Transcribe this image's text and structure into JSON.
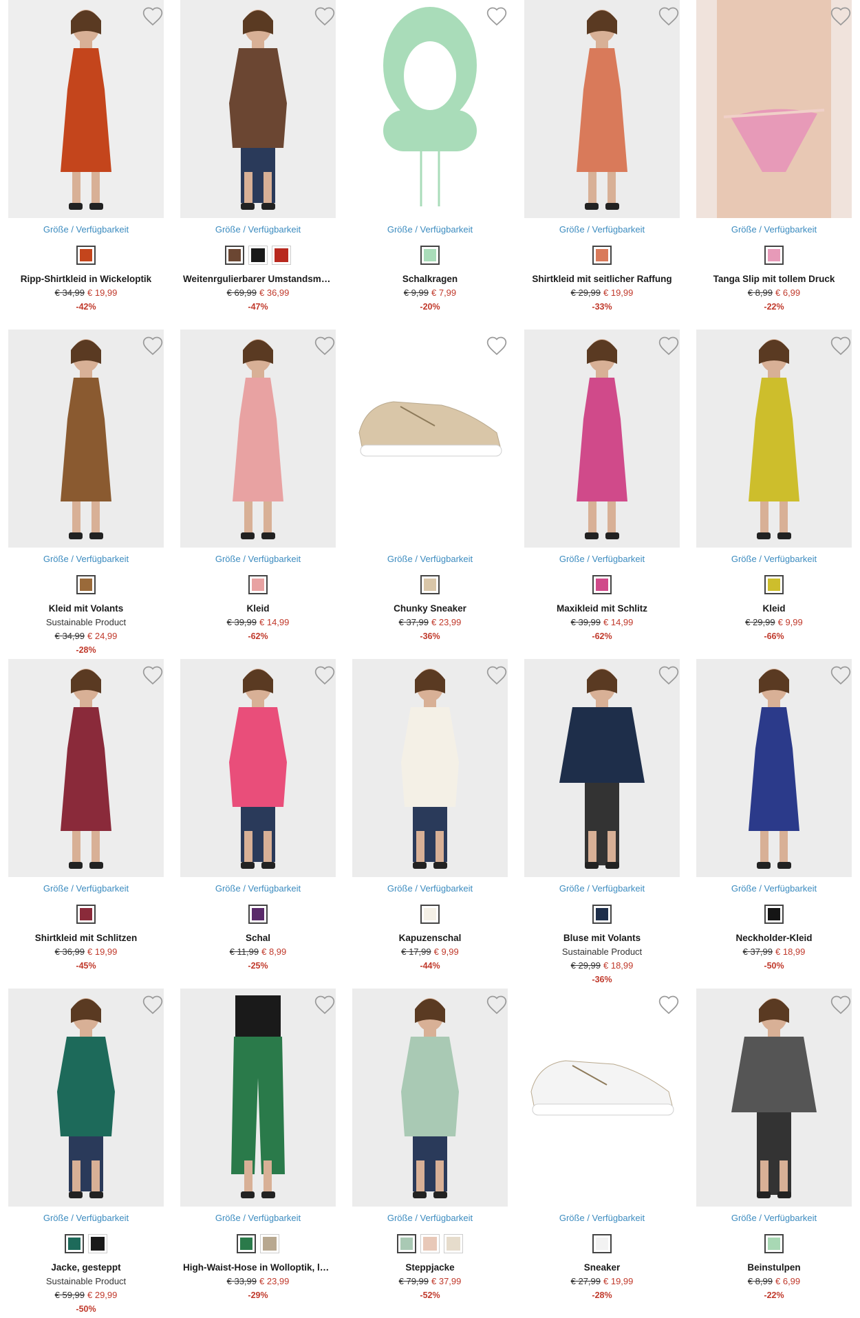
{
  "labels": {
    "availability": "Größe / Verfügbarkeit"
  },
  "products": [
    {
      "name": "Ripp-Shirtkleid in Wickeloptik",
      "sub": "",
      "old_price": "€ 34,99",
      "new_price": "€ 19,99",
      "discount": "-42%",
      "swatches": [
        "#c4451c"
      ],
      "bg": "#eeeeee",
      "item": "#c4451c",
      "kind": "dress"
    },
    {
      "name": "Weitenrgulierbarer Umstandsmant...",
      "sub": "",
      "old_price": "€ 69,99",
      "new_price": "€ 36,99",
      "discount": "-47%",
      "swatches": [
        "#6b4632",
        "#1a1a1a",
        "#b8281e"
      ],
      "bg": "#ededed",
      "item": "#6b4632",
      "kind": "coat"
    },
    {
      "name": "Schalkragen",
      "sub": "",
      "old_price": "€ 9,99",
      "new_price": "€ 7,99",
      "discount": "-20%",
      "swatches": [
        "#a9dcb9"
      ],
      "bg": "#ffffff",
      "item": "#a9dcb9",
      "kind": "hood"
    },
    {
      "name": "Shirtkleid mit seitlicher Raffung",
      "sub": "",
      "old_price": "€ 29,99",
      "new_price": "€ 19,99",
      "discount": "-33%",
      "swatches": [
        "#d97a5a"
      ],
      "bg": "#ececec",
      "item": "#d97a5a",
      "kind": "dress"
    },
    {
      "name": "Tanga Slip mit tollem Druck",
      "sub": "",
      "old_price": "€ 8,99",
      "new_price": "€ 6,99",
      "discount": "-22%",
      "swatches": [
        "#e79ab8"
      ],
      "bg": "#f0e3dc",
      "item": "#e79ab8",
      "kind": "slip"
    },
    {
      "name": "Kleid mit Volants",
      "sub": "Sustainable Product",
      "old_price": "€ 34,99",
      "new_price": "€ 24,99",
      "discount": "-28%",
      "swatches": [
        "#9a6a3a"
      ],
      "bg": "#ececec",
      "item": "#8a5a30",
      "kind": "dress"
    },
    {
      "name": "Kleid",
      "sub": "",
      "old_price": "€ 39,99",
      "new_price": "€ 14,99",
      "discount": "-62%",
      "swatches": [
        "#e8a2a2"
      ],
      "bg": "#ececec",
      "item": "#e8a2a2",
      "kind": "dress"
    },
    {
      "name": "Chunky Sneaker",
      "sub": "",
      "old_price": "€ 37,99",
      "new_price": "€ 23,99",
      "discount": "-36%",
      "swatches": [
        "#d9c6a8"
      ],
      "bg": "#ffffff",
      "item": "#d9c6a8",
      "kind": "shoe"
    },
    {
      "name": "Maxikleid mit Schlitz",
      "sub": "",
      "old_price": "€ 39,99",
      "new_price": "€ 14,99",
      "discount": "-62%",
      "swatches": [
        "#d04a8a"
      ],
      "bg": "#ececec",
      "item": "#d04a8a",
      "kind": "dress"
    },
    {
      "name": "Kleid",
      "sub": "",
      "old_price": "€ 29,99",
      "new_price": "€ 9,99",
      "discount": "-66%",
      "swatches": [
        "#cdbe2c"
      ],
      "bg": "#ececec",
      "item": "#cdbe2c",
      "kind": "dress"
    },
    {
      "name": "Shirtkleid mit Schlitzen",
      "sub": "",
      "old_price": "€ 36,99",
      "new_price": "€ 19,99",
      "discount": "-45%",
      "swatches": [
        "#8a2a3a"
      ],
      "bg": "#ededed",
      "item": "#8a2a3a",
      "kind": "dress"
    },
    {
      "name": "Schal",
      "sub": "",
      "old_price": "€ 11,99",
      "new_price": "€ 8,99",
      "discount": "-25%",
      "swatches": [
        "#5a2a6a"
      ],
      "bg": "#ececec",
      "item": "#e94e7a",
      "kind": "coat"
    },
    {
      "name": "Kapuzenschal",
      "sub": "",
      "old_price": "€ 17,99",
      "new_price": "€ 9,99",
      "discount": "-44%",
      "swatches": [
        "#f4f0e6"
      ],
      "bg": "#ececec",
      "item": "#f4f0e6",
      "kind": "coat"
    },
    {
      "name": "Bluse mit Volants",
      "sub": "Sustainable Product",
      "old_price": "€ 29,99",
      "new_price": "€ 18,99",
      "discount": "-36%",
      "swatches": [
        "#1e2e4a"
      ],
      "bg": "#ececec",
      "item": "#1e2e4a",
      "kind": "top"
    },
    {
      "name": "Neckholder-Kleid",
      "sub": "",
      "old_price": "€ 37,99",
      "new_price": "€ 18,99",
      "discount": "-50%",
      "swatches": [
        "#151515"
      ],
      "bg": "#ececec",
      "item": "#2b3a8a",
      "kind": "dress"
    },
    {
      "name": "Jacke, gesteppt",
      "sub": "Sustainable Product",
      "old_price": "€ 59,99",
      "new_price": "€ 29,99",
      "discount": "-50%",
      "swatches": [
        "#1d6a5a",
        "#1a1a1a"
      ],
      "bg": "#ececec",
      "item": "#1d6a5a",
      "kind": "coat"
    },
    {
      "name": "High-Waist-Hose in Wolloptik, lang",
      "sub": "",
      "old_price": "€ 33,99",
      "new_price": "€ 23,99",
      "discount": "-29%",
      "swatches": [
        "#2a7a4a",
        "#b8a890"
      ],
      "bg": "#ececec",
      "item": "#2a7a4a",
      "kind": "pants"
    },
    {
      "name": "Steppjacke",
      "sub": "",
      "old_price": "€ 79,99",
      "new_price": "€ 37,99",
      "discount": "-52%",
      "swatches": [
        "#a9c9b4",
        "#e8c8b8",
        "#e6dccc"
      ],
      "bg": "#ececec",
      "item": "#a9c9b4",
      "kind": "coat"
    },
    {
      "name": "Sneaker",
      "sub": "",
      "old_price": "€ 27,99",
      "new_price": "€ 19,99",
      "discount": "-28%",
      "swatches": [
        "#f2f2f2"
      ],
      "bg": "#ffffff",
      "item": "#f4f4f4",
      "kind": "shoe"
    },
    {
      "name": "Beinstulpen",
      "sub": "",
      "old_price": "€ 8,99",
      "new_price": "€ 6,99",
      "discount": "-22%",
      "swatches": [
        "#a8d8b4"
      ],
      "bg": "#ececec",
      "item": "#555555",
      "kind": "top"
    }
  ]
}
